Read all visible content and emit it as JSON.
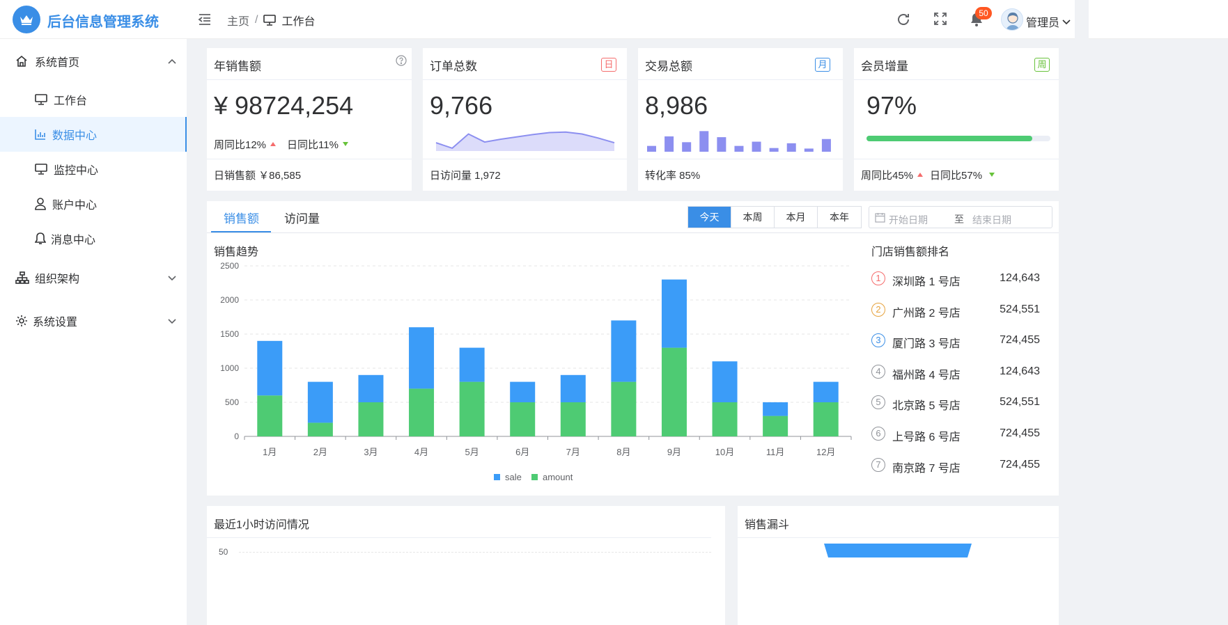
{
  "app": {
    "title": "后台信息管理系统",
    "user": "管理员",
    "notify_count": "50"
  },
  "breadcrumb": {
    "home": "主页",
    "sep": "/",
    "current": "工作台"
  },
  "sidebar": {
    "items": [
      {
        "label": "系统首页"
      },
      {
        "label": "工作台"
      },
      {
        "label": "数据中心"
      },
      {
        "label": "监控中心"
      },
      {
        "label": "账户中心"
      },
      {
        "label": "消息中心"
      },
      {
        "label": "组织架构"
      },
      {
        "label": "系统设置"
      }
    ]
  },
  "cards": {
    "sales": {
      "title": "年销售额",
      "value": "¥ 98724,254",
      "wow": "周同比12%",
      "dod": "日同比11%",
      "foot": "日销售额 ￥86,585"
    },
    "orders": {
      "title": "订单总数",
      "tag": "日",
      "value": "9,766",
      "foot": "日访问量 1,972",
      "spark": [
        0.35,
        0.12,
        0.72,
        0.38,
        0.5,
        0.6,
        0.7,
        0.78,
        0.8,
        0.72,
        0.55,
        0.35
      ]
    },
    "trade": {
      "title": "交易总额",
      "tag": "月",
      "value": "8,986",
      "foot": "转化率 85%",
      "bars": [
        0.22,
        0.58,
        0.36,
        0.78,
        0.55,
        0.22,
        0.38,
        0.14,
        0.32,
        0.12,
        0.48
      ]
    },
    "members": {
      "title": "会员增量",
      "tag": "周",
      "value": "97%",
      "progress": 0.9,
      "wow": "周同比45%",
      "dod": "日同比57%"
    }
  },
  "panel": {
    "tabs": [
      "销售额",
      "访问量"
    ],
    "ranges": [
      "今天",
      "本周",
      "本月",
      "本年"
    ],
    "date_start": "开始日期",
    "date_to": "至",
    "date_end": "结束日期",
    "chart_title": "销售趋势",
    "rank_title": "门店销售额排名",
    "ranking": [
      {
        "no": "1",
        "name": "深圳路 1 号店",
        "value": "124,643"
      },
      {
        "no": "2",
        "name": "广州路 2 号店",
        "value": "524,551"
      },
      {
        "no": "3",
        "name": "厦门路 3 号店",
        "value": "724,455"
      },
      {
        "no": "4",
        "name": "福州路 4 号店",
        "value": "124,643"
      },
      {
        "no": "5",
        "name": "北京路 5 号店",
        "value": "524,551"
      },
      {
        "no": "6",
        "name": "上号路 6 号店",
        "value": "724,455"
      },
      {
        "no": "7",
        "name": "南京路 7 号店",
        "value": "724,455"
      }
    ]
  },
  "bottom": {
    "visits_title": "最近1小时访问情况",
    "visits_ytick": "50",
    "funnel_title": "销售漏斗"
  },
  "colors": {
    "accent": "#3a8ee6",
    "sale": "#3b9cf8",
    "amount": "#4ecb73",
    "spark": "#8c8ff0"
  },
  "chart_data": {
    "type": "bar",
    "stacked": true,
    "categories": [
      "1月",
      "2月",
      "3月",
      "4月",
      "5月",
      "6月",
      "7月",
      "8月",
      "9月",
      "10月",
      "11月",
      "12月"
    ],
    "series": [
      {
        "name": "sale",
        "values": [
          800,
          600,
          400,
          900,
          500,
          300,
          400,
          900,
          1000,
          600,
          200,
          300
        ]
      },
      {
        "name": "amount",
        "values": [
          600,
          200,
          500,
          700,
          800,
          500,
          500,
          800,
          1300,
          500,
          300,
          500
        ]
      }
    ],
    "yticks": [
      "0",
      "500",
      "1000",
      "1500",
      "2000",
      "2500"
    ],
    "ylim": [
      0,
      2500
    ],
    "legend": "bottom",
    "grid": true
  }
}
